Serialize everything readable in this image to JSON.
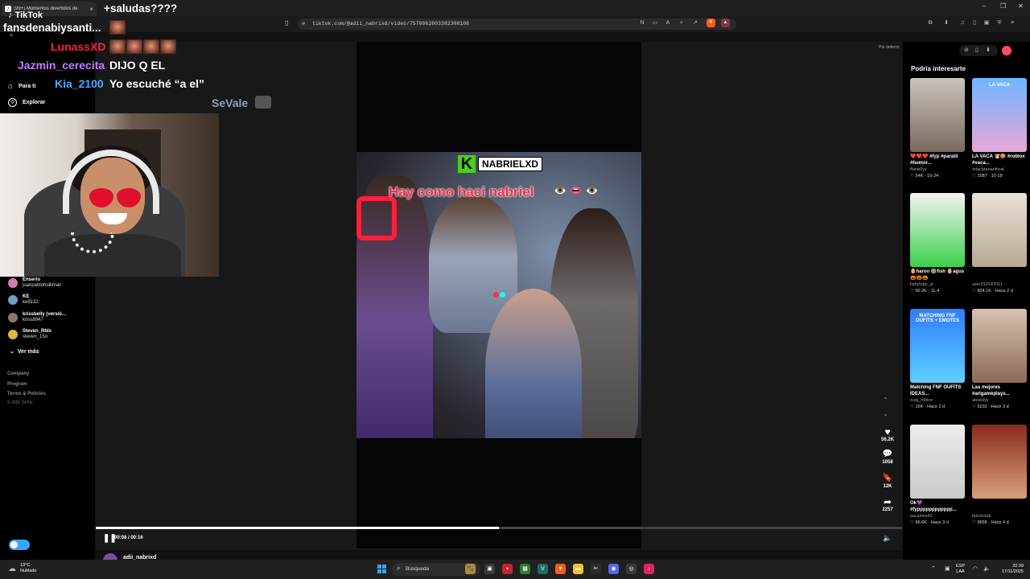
{
  "browser": {
    "tab_title": "(99+) Momentos divertidos de",
    "tab_icon": "tiktok-icon",
    "url": "tiktok.com/@adii_nabrixd/video/7570062803382308108",
    "window_controls": [
      "minimize-icon",
      "restore-icon",
      "close-icon"
    ]
  },
  "sidebar": {
    "logo": "TikTok",
    "nav": [
      {
        "label": "Para ti",
        "icon": "home-icon"
      },
      {
        "label": "Explorar",
        "icon": "compass-icon"
      }
    ],
    "following": [
      {
        "name": "Enserio",
        "handle": "juanpabloholliman",
        "color": "#d87bb0"
      },
      {
        "name": "KE",
        "handle": "ke8132",
        "color": "#6fa0c8"
      },
      {
        "name": "krissbelly (versió...",
        "handle": "kriss8947",
        "color": "#8a7a66"
      },
      {
        "name": "Steven_Rblx",
        "handle": "steven_15o",
        "color": "#e0b840"
      }
    ],
    "see_more": "Ver más",
    "footer": [
      "Company",
      "Program",
      "Terms & Policies"
    ],
    "copyright": "© 2025 TikTok"
  },
  "overlay_chat": [
    {
      "user": "fansdenabiysanti...",
      "user_color": "#ffffff",
      "msg": "saludas????",
      "prefix": "+"
    },
    {
      "user": "LunassXD",
      "user_color": "#ff1f3d",
      "msg": ""
    },
    {
      "user": "Jazmin_cerecita",
      "user_color": "#c37bff",
      "msg": "DIJO Q EL"
    },
    {
      "user": "Kia_2100",
      "user_color": "#4aa8ff",
      "msg": "Yo escuché “a el”"
    },
    {
      "user": "SeVale",
      "user_color": "#8aa0c0",
      "msg": ""
    }
  ],
  "video": {
    "tag_letter": "K",
    "tag_name": "NABRIELXD",
    "caption": "Hay como haci nabriel",
    "caption_emoji": "👁️ 👄 👁️",
    "fit_label": "Por defecto",
    "progress": 0.5,
    "time": "00:08 / 00:16",
    "author": "adii_nabrixd"
  },
  "actions": [
    {
      "icon": "heart-icon",
      "glyph": "♥",
      "count": "56.2K"
    },
    {
      "icon": "comment-icon",
      "glyph": "💬",
      "count": "1058"
    },
    {
      "icon": "bookmark-icon",
      "glyph": "🔖",
      "count": "12K"
    },
    {
      "icon": "share-icon",
      "glyph": "➦",
      "count": "2257"
    }
  ],
  "recommendations": {
    "title": "Podría interesarte",
    "items": [
      {
        "title": "❤️❤️❤️ #fyp #paratii #humor...",
        "user": "ffanb0yy",
        "likes": "54K",
        "date": "10-24",
        "bg": "linear-gradient(180deg,#c9c4bd,#7a6a5c)",
        "thumb_text": ""
      },
      {
        "title": "LA VACA 🐮🍪 #roblox #vaca...",
        "user": "srtacatanaoficial",
        "likes": "1087",
        "date": "10-18",
        "bg": "linear-gradient(180deg,#6fb6ff,#e9a6d9)",
        "thumb_text": "LA VACA"
      },
      {
        "title": "🥚haroo 🟢fish 🥚agus 🎃🎃🎃",
        "user": "fishchips_yt",
        "likes": "50.2K",
        "date": "11-4",
        "bg": "linear-gradient(180deg,#f4f4f4,#3bd04a)",
        "thumb_text": ""
      },
      {
        "title": "",
        "user": "user012147011",
        "likes": "604.1K",
        "date": "Hace 2 d",
        "bg": "linear-gradient(180deg,#e8e2d8,#b8a890)",
        "thumb_text": ""
      },
      {
        "title": "Matching FNF OUFITS IDEAS...",
        "user": "zuaj_roblox",
        "likes": "16K",
        "date": "Hace 2 d",
        "bg": "linear-gradient(180deg,#2f7dff,#5ed0ff)",
        "thumb_text": "MATCHING FNF OUFITS + EMOTES"
      },
      {
        "title": "Las mejores #arlgameplays...",
        "user": "alexislyy",
        "likes": "5232",
        "date": "Hace 3 d",
        "bg": "linear-gradient(180deg,#d8c2b0,#8c6b55)",
        "thumb_text": ""
      },
      {
        "title": "Ok💜 #fypppppppppppp...",
        "user": "isa.alvez42",
        "likes": "66.6K",
        "date": "Hace 3 d",
        "bg": "linear-gradient(180deg,#ececec,#c9c9c9)",
        "thumb_text": ""
      },
      {
        "title": "",
        "user": "botchclub",
        "likes": "9656",
        "date": "Hace 4 d",
        "bg": "linear-gradient(180deg,#8a2a1e,#d9a079)",
        "thumb_text": ""
      }
    ]
  },
  "taskbar": {
    "temp": "13°C",
    "weather": "Nublado",
    "search": "Búsqueda",
    "lang_top": "ESP",
    "lang_bottom": "LAA",
    "time": "20:39",
    "date": "17/11/2025"
  }
}
